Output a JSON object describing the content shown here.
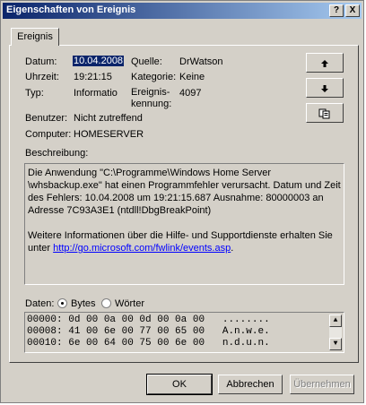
{
  "window": {
    "title": "Eigenschaften von Ereignis",
    "help_label": "?",
    "close_label": "X"
  },
  "tabs": [
    {
      "label": "Ereignis"
    }
  ],
  "fields": {
    "datum_label": "Datum:",
    "datum_value": "10.04.2008",
    "uhrzeit_label": "Uhrzeit:",
    "uhrzeit_value": "19:21:15",
    "typ_label": "Typ:",
    "typ_value": "Informatio",
    "benutzer_label": "Benutzer:",
    "benutzer_value": "Nicht zutreffend",
    "computer_label": "Computer:",
    "computer_value": "HOMESERVER",
    "quelle_label": "Quelle:",
    "quelle_value": "DrWatson",
    "kategorie_label": "Kategorie:",
    "kategorie_value": "Keine",
    "kennung_label_1": "Ereignis-",
    "kennung_label_2": "kennung:",
    "kennung_value": "4097"
  },
  "nav": {
    "up_icon": "arrow-up-icon",
    "down_icon": "arrow-down-icon",
    "copy_icon": "copy-icon"
  },
  "description": {
    "label": "Beschreibung:",
    "line1": "Die Anwendung \"C:\\Programme\\Windows Home Server \\whsbackup.exe\" hat einen Programmfehler verursacht. Datum und Zeit des Fehlers: 10.04.2008 um 19:21:15.687 Ausnahme: 80000003 an Adresse 7C93A3E1 (ntdll!DbgBreakPoint)",
    "line2_prefix": "Weitere Informationen über die Hilfe- und Supportdienste erhalten Sie unter ",
    "link": "http://go.microsoft.com/fwlink/events.asp",
    "line2_suffix": "."
  },
  "data_section": {
    "label": "Daten:",
    "bytes_label": "Bytes",
    "words_label": "Wörter",
    "selected": "Bytes"
  },
  "hex_rows": [
    {
      "offset": "00000:",
      "bytes": "0d 00 0a 00 0d 00 0a 00",
      "ascii": "........"
    },
    {
      "offset": "00008:",
      "bytes": "41 00 6e 00 77 00 65 00",
      "ascii": "A.n.w.e."
    },
    {
      "offset": "00010:",
      "bytes": "6e 00 64 00 75 00 6e 00",
      "ascii": "n.d.u.n."
    }
  ],
  "buttons": {
    "ok": "OK",
    "cancel": "Abbrechen",
    "apply": "Übernehmen"
  }
}
